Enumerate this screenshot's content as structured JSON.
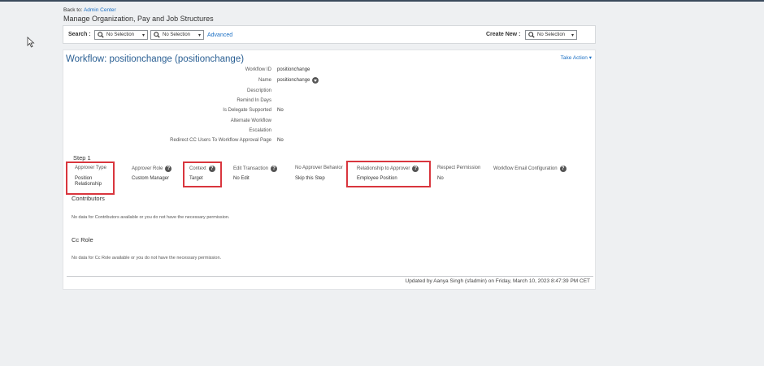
{
  "header": {
    "back_prefix": "Back to:",
    "back_link": "Admin Center",
    "page_title": "Manage Organization, Pay and Job Structures"
  },
  "search": {
    "label": "Search :",
    "select1": "No Selection",
    "select2": "No Selection",
    "advanced": "Advanced",
    "create_label": "Create New :",
    "create_select": "No Selection"
  },
  "workflow": {
    "title": "Workflow: positionchange (positionchange)",
    "take_action": "Take Action",
    "fields": [
      {
        "label": "Workflow ID",
        "value": "positionchange"
      },
      {
        "label": "Name",
        "value": "positionchange"
      },
      {
        "label": "Description",
        "value": ""
      },
      {
        "label": "Remind In Days",
        "value": ""
      },
      {
        "label": "Is Delegate Supported",
        "value": "No"
      },
      {
        "label": "Alternate Workflow",
        "value": ""
      },
      {
        "label": "Escalation",
        "value": ""
      },
      {
        "label": "Redirect CC Users To Workflow Approval Page",
        "value": "No"
      }
    ]
  },
  "step": {
    "title": "Step 1",
    "columns": [
      {
        "header": "Approver Type",
        "value": "Position Relationship"
      },
      {
        "header": "Approver Role",
        "value": "Custom Manager"
      },
      {
        "header": "Context",
        "value": "Target"
      },
      {
        "header": "Edit Transaction",
        "value": "No Edit"
      },
      {
        "header": "No Approver Behavior",
        "value": "Skip this Step"
      },
      {
        "header": "Relationship to Approver",
        "value": "Employee Position"
      },
      {
        "header": "Respect Permission",
        "value": "No"
      },
      {
        "header": "Workflow Email Configuration",
        "value": ""
      }
    ]
  },
  "contributors": {
    "title": "Contributors",
    "empty": "No data for Contributors available or you do not have the necessary permission."
  },
  "cc_role": {
    "title": "Cc Role",
    "empty": "No data for Cc Role available or you do not have the necessary permission."
  },
  "footer": {
    "updated": "Updated by Aanya Singh (sfadmin) on Friday, March 10, 2023 8:47:39 PM CET"
  },
  "colors": {
    "link": "#1a6fc4",
    "title": "#2a5f93",
    "highlight": "#d9363e"
  }
}
